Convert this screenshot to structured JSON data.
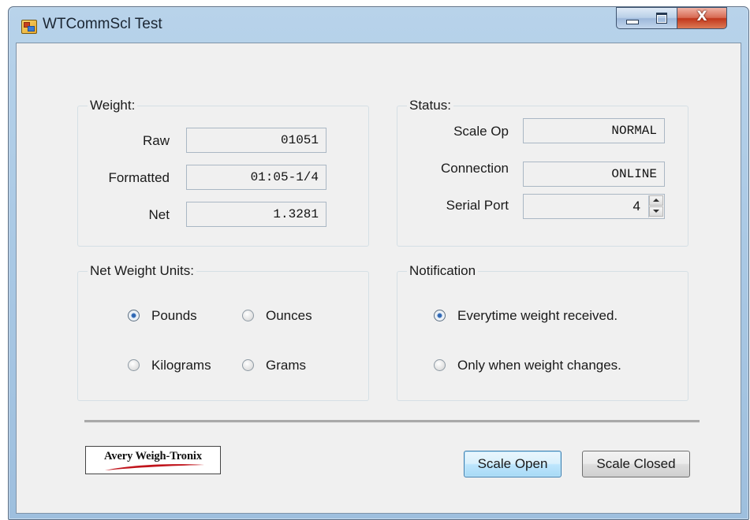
{
  "window": {
    "title": "WTCommScl Test",
    "icon": "app-form-icon",
    "controls": {
      "minimize": "minimize-icon",
      "maximize": "maximize-icon",
      "close_glyph": "X"
    }
  },
  "weight": {
    "label": "Weight:",
    "raw": {
      "label": "Raw",
      "value": "01051"
    },
    "formatted": {
      "label": "Formatted",
      "value": "01:05-1/4"
    },
    "net": {
      "label": "Net",
      "value": "1.3281"
    }
  },
  "status": {
    "label": "Status:",
    "scale_op": {
      "label": "Scale Op",
      "value": "NORMAL"
    },
    "connection": {
      "label": "Connection",
      "value": "ONLINE"
    },
    "serial_port": {
      "label": "Serial Port",
      "value": "4"
    }
  },
  "units": {
    "label": "Net Weight Units:",
    "options": [
      "Pounds",
      "Ounces",
      "Kilograms",
      "Grams"
    ],
    "selected": "Pounds"
  },
  "notification": {
    "label": "Notification",
    "options": [
      "Everytime weight received.",
      "Only when weight changes."
    ],
    "selected": "Everytime weight received."
  },
  "logo": {
    "text": "Avery Weigh-Tronix",
    "swoosh_color": "#c0141c"
  },
  "buttons": {
    "open": "Scale Open",
    "closed": "Scale Closed"
  },
  "colors": {
    "title_bar": "#a9c8e4",
    "close_button": "#c1361b",
    "radio_selected": "#2a5fa8",
    "default_button_border": "#3c7fb1"
  }
}
